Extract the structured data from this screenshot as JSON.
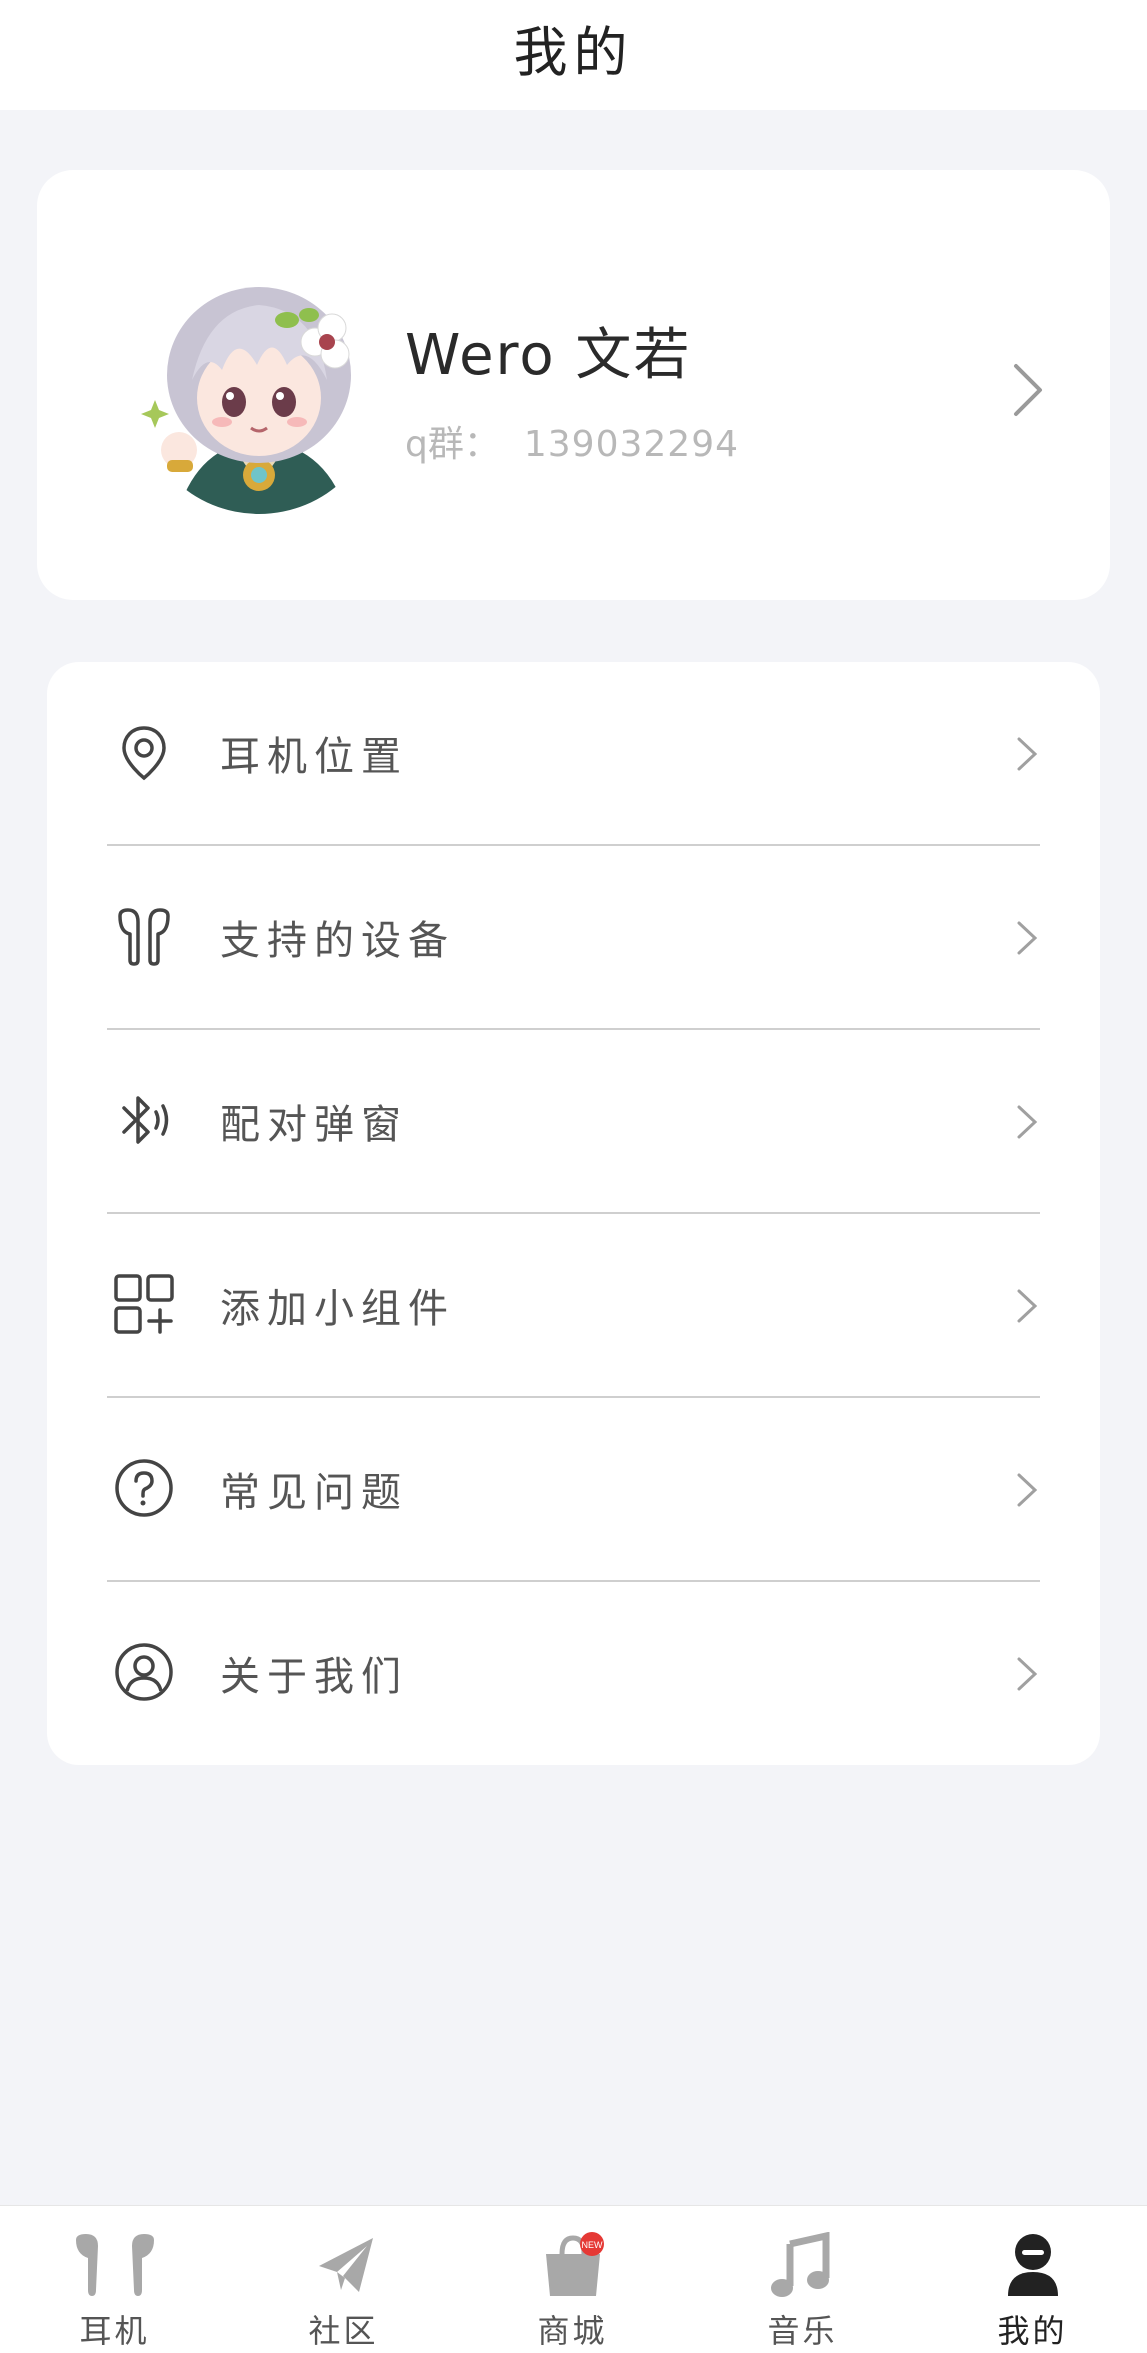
{
  "header": {
    "title": "我的"
  },
  "profile": {
    "name": "Wero 文若",
    "qq_label": "q群：",
    "qq_value": "139032294"
  },
  "menu": {
    "items": [
      {
        "label": "耳机位置",
        "icon": "location-pin-icon"
      },
      {
        "label": "支持的设备",
        "icon": "earbuds-icon"
      },
      {
        "label": "配对弹窗",
        "icon": "bluetooth-icon"
      },
      {
        "label": "添加小组件",
        "icon": "widgets-icon"
      },
      {
        "label": "常见问题",
        "icon": "help-circle-icon"
      },
      {
        "label": "关于我们",
        "icon": "user-circle-icon"
      }
    ]
  },
  "tabbar": {
    "tabs": [
      {
        "label": "耳机",
        "icon": "earphones-icon"
      },
      {
        "label": "社区",
        "icon": "paper-plane-icon"
      },
      {
        "label": "商城",
        "icon": "shopping-bag-icon",
        "badge": "NEW"
      },
      {
        "label": "音乐",
        "icon": "music-note-icon"
      },
      {
        "label": "我的",
        "icon": "person-icon"
      }
    ],
    "active_index": 4
  },
  "colors": {
    "background": "#f3f4f8",
    "card": "#ffffff",
    "divider": "#cfcfcf",
    "inactive_icon": "#a8a8a8",
    "active_icon": "#222222",
    "badge": "#e53935"
  }
}
